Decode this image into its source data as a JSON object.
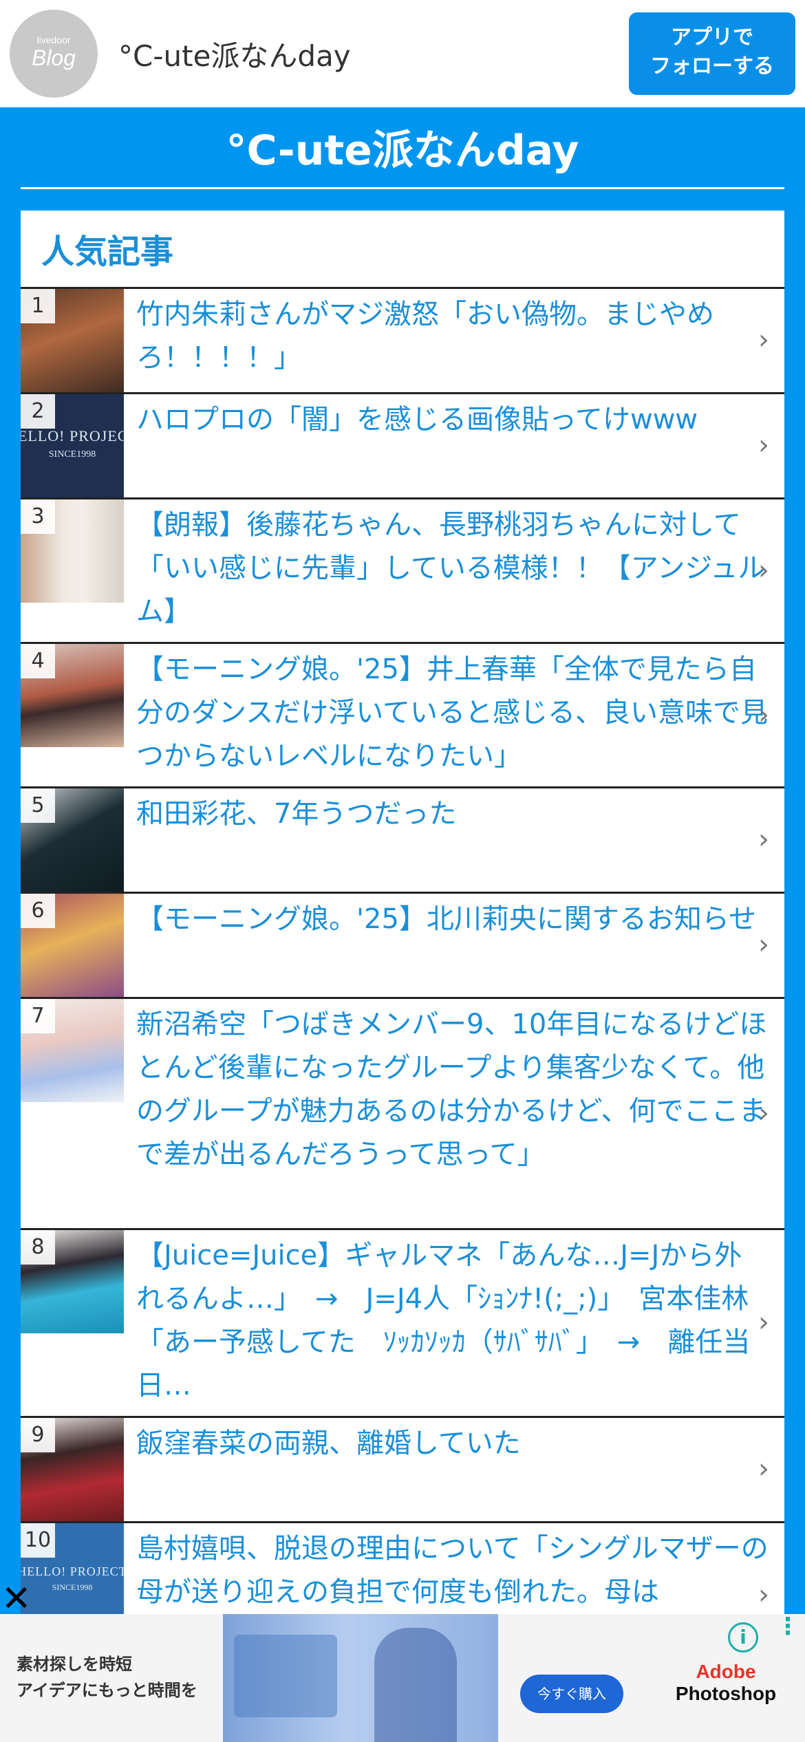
{
  "topbar": {
    "logo_small": "livedoor",
    "logo_big": "Blog",
    "site_name": "°C-ute派なんday",
    "follow_line1": "アプリで",
    "follow_line2": "フォローする"
  },
  "header": {
    "title": "°C-ute派なんday"
  },
  "popular": {
    "heading": "人気記事",
    "items": [
      {
        "rank": "1",
        "title": "竹内朱莉さんがマジ激怒「おい偽物。まじやめろ！！！！」"
      },
      {
        "rank": "2",
        "title": "ハロプロの「闇」を感じる画像貼ってけwww",
        "thumb_text": "HELLO! PROJECT",
        "thumb_sub": "SINCE1998"
      },
      {
        "rank": "3",
        "title": "【朗報】後藤花ちゃん、長野桃羽ちゃんに対して「いい感じに先輩」している模様！！【アンジュルム】"
      },
      {
        "rank": "4",
        "title": "【モーニング娘。'25】井上春華「全体で見たら自分のダンスだけ浮いていると感じる、良い意味で見つからないレベルになりたい」"
      },
      {
        "rank": "5",
        "title": "和田彩花、7年うつだった"
      },
      {
        "rank": "6",
        "title": "【モーニング娘。'25】北川莉央に関するお知らせ"
      },
      {
        "rank": "7",
        "title": "新沼希空「つばきメンバー9、10年目になるけどほとんど後輩になったグループより集客少なくて。他のグループが魅力あるのは分かるけど、何でここまで差が出るんだろうって思って」"
      },
      {
        "rank": "8",
        "title": "【Juice=Juice】ギャルマネ「あんな…J=Jから外れるんよ…」　→　J=J4人「ｼｮﾝﾅ!(;_;)」　宮本佳林「あー予感してた　ｿｯｶｿｯｶ（ｻﾊﾞｻﾊﾞ」　→　離任当日…"
      },
      {
        "rank": "9",
        "title": "飯窪春菜の両親、離婚していた"
      },
      {
        "rank": "10",
        "title": "島村嬉唄、脱退の理由について「シングルマザーの母が送り迎えの負担で何度も倒れた。母は",
        "thumb_text": "HELLO! PROJECT",
        "thumb_sub": "SINCE1998"
      }
    ]
  },
  "ad": {
    "text_line1": "素材探しを時短",
    "text_line2": "アイデアにもっと時間を",
    "cta": "今すぐ購入",
    "brand_line1": "Adobe",
    "brand_line2": "Photoshop"
  }
}
